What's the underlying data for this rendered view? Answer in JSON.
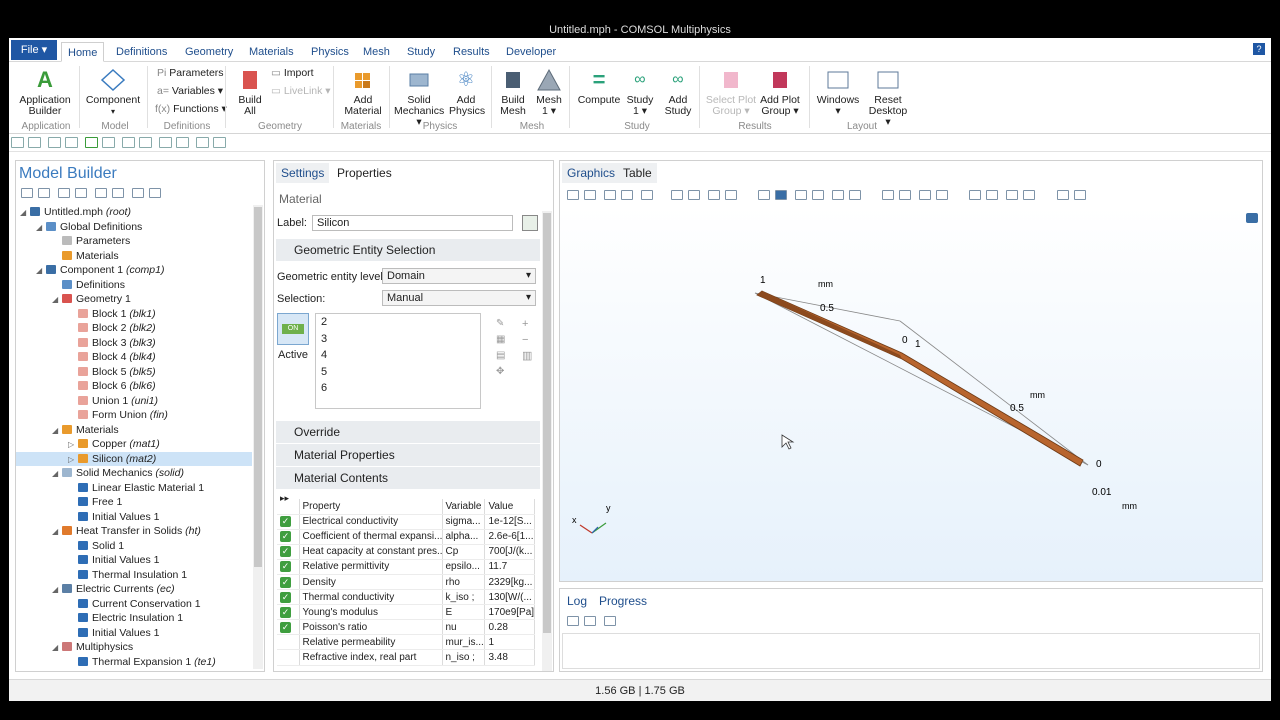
{
  "window": {
    "title": "Untitled.mph - COMSOL Multiphysics"
  },
  "menu": {
    "file": "File ▾",
    "tabs": [
      "Home",
      "Definitions",
      "Geometry",
      "Materials",
      "Physics",
      "Mesh",
      "Study",
      "Results",
      "Developer"
    ],
    "help": "?"
  },
  "ribbon": {
    "application_builder": "Application Builder",
    "component": "Component",
    "parameters": "Parameters",
    "variables": "Variables ▾",
    "functions": "Functions ▾",
    "build_all": "Build All",
    "import": "Import",
    "livelink": "LiveLink ▾",
    "add_material": "Add Material",
    "solid_mechanics": "Solid Mechanics ▾",
    "add_physics": "Add Physics",
    "build_mesh": "Build Mesh",
    "mesh1": "Mesh 1 ▾",
    "compute": "Compute",
    "study1": "Study 1 ▾",
    "add_study": "Add Study",
    "select_plot_group": "Select Plot Group ▾",
    "add_plot_group": "Add Plot Group ▾",
    "windows": "Windows ▾",
    "reset_desktop": "Reset Desktop ▾",
    "groups": [
      "Application",
      "Model",
      "Definitions",
      "Geometry",
      "Materials",
      "Physics",
      "Mesh",
      "Study",
      "Results",
      "Layout"
    ]
  },
  "model_builder": {
    "title": "Model Builder",
    "tree": [
      {
        "label": "Untitled.mph",
        "tag": "(root)"
      },
      {
        "label": "Global Definitions",
        "tag": ""
      },
      {
        "label": "Parameters",
        "tag": ""
      },
      {
        "label": "Materials",
        "tag": ""
      },
      {
        "label": "Component 1",
        "tag": "(comp1)"
      },
      {
        "label": "Definitions",
        "tag": ""
      },
      {
        "label": "Geometry 1",
        "tag": ""
      },
      {
        "label": "Block 1",
        "tag": "(blk1)"
      },
      {
        "label": "Block 2",
        "tag": "(blk2)"
      },
      {
        "label": "Block 3",
        "tag": "(blk3)"
      },
      {
        "label": "Block 4",
        "tag": "(blk4)"
      },
      {
        "label": "Block 5",
        "tag": "(blk5)"
      },
      {
        "label": "Block 6",
        "tag": "(blk6)"
      },
      {
        "label": "Union 1",
        "tag": "(uni1)"
      },
      {
        "label": "Form Union",
        "tag": "(fin)"
      },
      {
        "label": "Materials",
        "tag": ""
      },
      {
        "label": "Copper",
        "tag": "(mat1)"
      },
      {
        "label": "Silicon",
        "tag": "(mat2)"
      },
      {
        "label": "Solid Mechanics",
        "tag": "(solid)"
      },
      {
        "label": "Linear Elastic Material 1",
        "tag": ""
      },
      {
        "label": "Free 1",
        "tag": ""
      },
      {
        "label": "Initial Values 1",
        "tag": ""
      },
      {
        "label": "Heat Transfer in Solids",
        "tag": "(ht)"
      },
      {
        "label": "Solid 1",
        "tag": ""
      },
      {
        "label": "Initial Values 1",
        "tag": ""
      },
      {
        "label": "Thermal Insulation 1",
        "tag": ""
      },
      {
        "label": "Electric Currents",
        "tag": "(ec)"
      },
      {
        "label": "Current Conservation 1",
        "tag": ""
      },
      {
        "label": "Electric Insulation 1",
        "tag": ""
      },
      {
        "label": "Initial Values 1",
        "tag": ""
      },
      {
        "label": "Multiphysics",
        "tag": ""
      },
      {
        "label": "Thermal Expansion 1",
        "tag": "(te1)"
      }
    ]
  },
  "settings": {
    "tabs": [
      "Settings",
      "Properties"
    ],
    "heading": "Material",
    "label_caption": "Label:",
    "label_value": "Silicon",
    "ges_header": "Geometric Entity Selection",
    "level_caption": "Geometric entity level:",
    "level_value": "Domain",
    "selection_caption": "Selection:",
    "selection_value": "Manual",
    "selection_items": [
      "2",
      "3",
      "4",
      "5",
      "6"
    ],
    "active": "Active",
    "active_icon": "ON",
    "sections": [
      "Override",
      "Material Properties",
      "Material Contents"
    ],
    "table_headers": [
      "Property",
      "Variable",
      "Value"
    ],
    "rows": [
      {
        "p": "Electrical conductivity",
        "v": "sigma...",
        "val": "1e-12[S...",
        "chk": true
      },
      {
        "p": "Coefficient of thermal expansi...",
        "v": "alpha...",
        "val": "2.6e-6[1...",
        "chk": true
      },
      {
        "p": "Heat capacity at constant pres...",
        "v": "Cp",
        "val": "700[J/(k...",
        "chk": true
      },
      {
        "p": "Relative permittivity",
        "v": "epsilo...",
        "val": "11.7",
        "chk": true
      },
      {
        "p": "Density",
        "v": "rho",
        "val": "2329[kg...",
        "chk": true
      },
      {
        "p": "Thermal conductivity",
        "v": "k_iso ;",
        "val": "130[W/(...",
        "chk": true
      },
      {
        "p": "Young's modulus",
        "v": "E",
        "val": "170e9[Pa]",
        "chk": true
      },
      {
        "p": "Poisson's ratio",
        "v": "nu",
        "val": "0.28",
        "chk": true
      },
      {
        "p": "Relative permeability",
        "v": "mur_is...",
        "val": "1",
        "chk": false
      },
      {
        "p": "Refractive index, real part",
        "v": "n_iso ;",
        "val": "3.48",
        "chk": false
      }
    ]
  },
  "graphics": {
    "tabs": [
      "Graphics",
      "Table"
    ],
    "axis_labels": [
      "1",
      "mm",
      "0.5",
      "0",
      "1",
      "mm",
      "0.5",
      "0",
      "0.01",
      "mm"
    ],
    "triad": [
      "x",
      "y"
    ]
  },
  "log": {
    "tabs": [
      "Log",
      "Progress"
    ]
  },
  "status": {
    "memory": "1.56 GB | 1.75 GB"
  },
  "colors": {
    "accent": "#1f57a4",
    "copper": "#b8652e",
    "selection": "#cde3f7"
  }
}
